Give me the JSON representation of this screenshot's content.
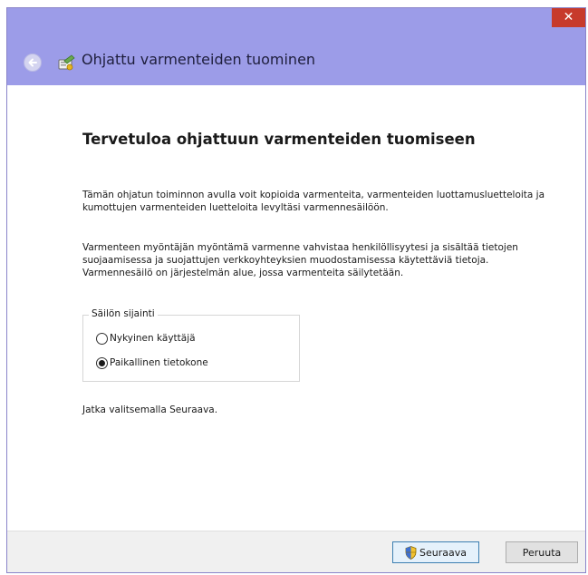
{
  "window": {
    "title": "Ohjattu varmenteiden tuominen",
    "close_label": "✕"
  },
  "icons": {
    "back": "back-arrow-icon",
    "app": "certificate-wizard-icon",
    "shield": "uac-shield-icon"
  },
  "content": {
    "heading": "Tervetuloa ohjattuun varmenteiden tuomiseen",
    "paragraph1": "Tämän ohjatun toiminnon avulla voit kopioida varmenteita, varmenteiden luottamusluetteloita ja kumottujen varmenteiden luetteloita levyltäsi varmennesäilöön.",
    "paragraph2": "Varmenteen myöntäjän myöntämä varmenne vahvistaa henkilöllisyytesi ja sisältää tietojen suojaamisessa ja suojattujen verkkoyhteyksien muodostamisessa käytettäviä tietoja. Varmennesäilö on järjestelmän alue, jossa varmenteita säilytetään.",
    "store_location": {
      "legend": "Säilön sijainti",
      "options": [
        {
          "label": "Nykyinen käyttäjä",
          "checked": false
        },
        {
          "label": "Paikallinen tietokone",
          "checked": true
        }
      ]
    },
    "continue_text": "Jatka valitsemalla Seuraava."
  },
  "footer": {
    "next_label": "Seuraava",
    "cancel_label": "Peruuta"
  },
  "colors": {
    "header_bg": "#9c9ce8",
    "close_bg": "#c73a2b",
    "primary_button_border": "#3c7fb1"
  }
}
